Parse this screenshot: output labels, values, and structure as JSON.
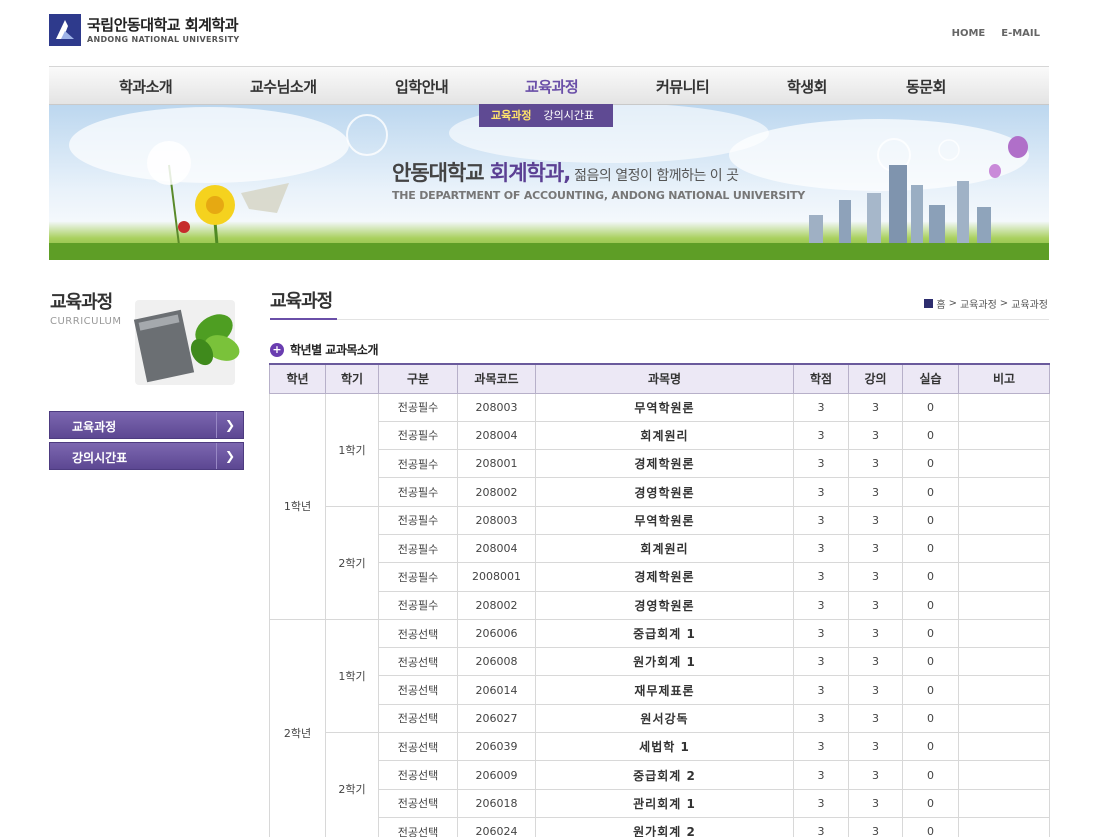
{
  "header": {
    "logo_title": "국립안동대학교 회계학과",
    "logo_sub": "ANDONG NATIONAL UNIVERSITY",
    "util_links": [
      "HOME",
      "E-MAIL"
    ]
  },
  "gnb": {
    "items": [
      "학과소개",
      "교수님소개",
      "입학안내",
      "교육과정",
      "커뮤니티",
      "학생회",
      "동문회"
    ],
    "active": "교육과정",
    "sub_items": [
      "교육과정",
      "강의시간표"
    ]
  },
  "banner": {
    "title_part1": "안동대학교 ",
    "title_accent": "회계학과,",
    "title_small": " 젊음의 열정이 함께하는 이 곳",
    "subtitle": "THE DEPARTMENT OF ACCOUNTING, ANDONG NATIONAL UNIVERSITY"
  },
  "sidebar": {
    "title": "교육과정",
    "subtitle": "CURRICULUM",
    "menu": [
      "교육과정",
      "강의시간표"
    ]
  },
  "content": {
    "title": "교육과정",
    "breadcrumb": [
      "홈",
      "교육과정",
      "교육과정"
    ],
    "section_title": "학년별 교과목소개"
  },
  "table": {
    "headers": [
      "학년",
      "학기",
      "구분",
      "과목코드",
      "과목명",
      "학점",
      "강의",
      "실습",
      "비고"
    ],
    "year_labels": [
      "1학년",
      "2학년"
    ],
    "semester_labels": [
      "1학기",
      "2학기",
      "1학기",
      "2학기"
    ],
    "rows": [
      [
        "전공필수",
        "208003",
        "무역학원론",
        "3",
        "3",
        "0",
        ""
      ],
      [
        "전공필수",
        "208004",
        "회계원리",
        "3",
        "3",
        "0",
        ""
      ],
      [
        "전공필수",
        "208001",
        "경제학원론",
        "3",
        "3",
        "0",
        ""
      ],
      [
        "전공필수",
        "208002",
        "경영학원론",
        "3",
        "3",
        "0",
        ""
      ],
      [
        "전공필수",
        "208003",
        "무역학원론",
        "3",
        "3",
        "0",
        ""
      ],
      [
        "전공필수",
        "208004",
        "회계원리",
        "3",
        "3",
        "0",
        ""
      ],
      [
        "전공필수",
        "2008001",
        "경제학원론",
        "3",
        "3",
        "0",
        ""
      ],
      [
        "전공필수",
        "208002",
        "경영학원론",
        "3",
        "3",
        "0",
        ""
      ],
      [
        "전공선택",
        "206006",
        "중급회계 1",
        "3",
        "3",
        "0",
        ""
      ],
      [
        "전공선택",
        "206008",
        "원가회계 1",
        "3",
        "3",
        "0",
        ""
      ],
      [
        "전공선택",
        "206014",
        "재무제표론",
        "3",
        "3",
        "0",
        ""
      ],
      [
        "전공선택",
        "206027",
        "원서강독",
        "3",
        "3",
        "0",
        ""
      ],
      [
        "전공선택",
        "206039",
        "세법학 1",
        "3",
        "3",
        "0",
        ""
      ],
      [
        "전공선택",
        "206009",
        "중급회계 2",
        "3",
        "3",
        "0",
        ""
      ],
      [
        "전공선택",
        "206018",
        "관리회계 1",
        "3",
        "3",
        "0",
        ""
      ],
      [
        "전공선택",
        "206024",
        "원가회계 2",
        "3",
        "3",
        "0",
        ""
      ]
    ]
  }
}
